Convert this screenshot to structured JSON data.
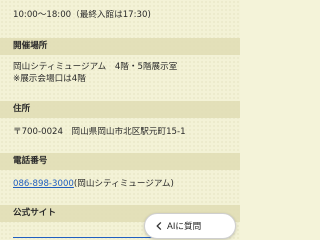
{
  "hours": {
    "value": "10:00～18:00（最終入館は17:30)"
  },
  "venue": {
    "heading": "開催場所",
    "line1": "岡山シティミュージアム　4階・5階展示室",
    "line2": "※展示会場口は4階"
  },
  "address": {
    "heading": "住所",
    "value": "〒700-0024　岡山県岡山市北区駅元町15-1"
  },
  "phone": {
    "heading": "電話番号",
    "number": "086-898-3000",
    "suffix": "(岡山シティミュージアム)"
  },
  "website": {
    "heading": "公式サイト"
  },
  "ai_button": {
    "label": "AIに質問",
    "icon": "chevron-left-icon"
  },
  "colors": {
    "background": "#f3f2d6",
    "heading_band": "#dfddb4",
    "link": "#1f5ec0"
  }
}
